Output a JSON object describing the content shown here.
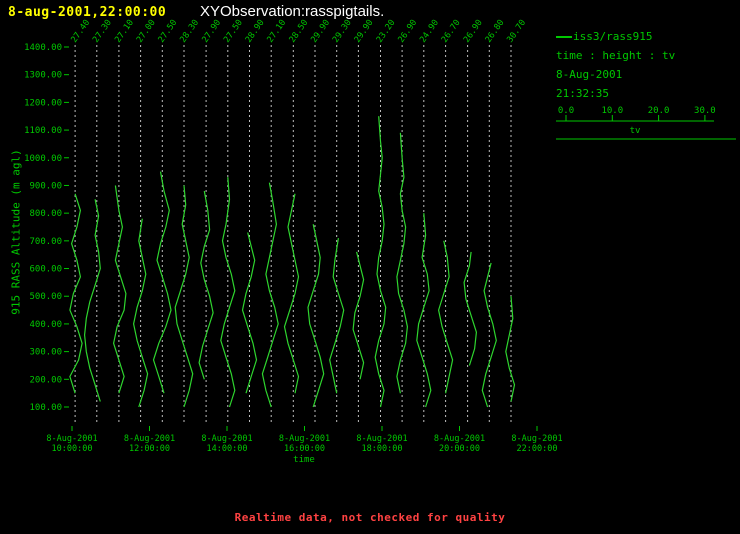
{
  "header": {
    "timestamp": "8-aug-2001,22:00:00",
    "title": "XYObservation:rasspigtails."
  },
  "legend": {
    "series_label": "iss3/rass915",
    "fields": "time : height : tv",
    "date": "8-Aug-2001",
    "time": "21:32:35"
  },
  "footer": {
    "notice": "Realtime data, not checked for quality"
  },
  "colors": {
    "background": "#000000",
    "green_text": "#00c800",
    "profile_green": "#2ed52e",
    "yellow": "#ffff00",
    "white": "#ffffff",
    "gridline_dash": "#e0e0e0",
    "red_notice": "#ff4242"
  },
  "chart_data": {
    "type": "line",
    "title": "XYObservation:rasspigtails.",
    "ylabel": "915 RASS Altitude (m agl)",
    "xlabel": "time",
    "ylim": [
      100,
      1400
    ],
    "yticks": [
      "1400.00",
      "1300.00",
      "1200.00",
      "1100.00",
      "1000.00",
      "900.00",
      "800.00",
      "700.00",
      "600.00",
      "500.00",
      "400.00",
      "300.00",
      "200.00",
      "100.00"
    ],
    "xticks": [
      {
        "hour": 10,
        "date": "8-Aug-2001",
        "time": "10:00:00"
      },
      {
        "hour": 12,
        "date": "8-Aug-2001",
        "time": "12:00:00"
      },
      {
        "hour": 14,
        "date": "8-Aug-2001",
        "time": "14:00:00"
      },
      {
        "hour": 16,
        "date": "8-Aug-2001",
        "time": "16:00:00"
      },
      {
        "hour": 18,
        "date": "8-Aug-2001",
        "time": "18:00:00"
      },
      {
        "hour": 20,
        "date": "8-Aug-2001",
        "time": "20:00:00"
      },
      {
        "hour": 22,
        "date": "8-Aug-2001",
        "time": "22:00:00"
      }
    ],
    "tv_axis": {
      "ticks": [
        "0.0",
        "10.0",
        "20.0",
        "30.0"
      ],
      "range": [
        0,
        30
      ],
      "label": "tv"
    },
    "profiles": [
      {
        "hour": 10.08,
        "label": "27.40",
        "points": [
          [
            150,
            0
          ],
          [
            210,
            -1.5
          ],
          [
            270,
            1
          ],
          [
            330,
            2
          ],
          [
            390,
            0.5
          ],
          [
            450,
            -1.5
          ],
          [
            510,
            -0.5
          ],
          [
            570,
            1.5
          ],
          [
            630,
            0.5
          ],
          [
            690,
            -1
          ],
          [
            750,
            0.5
          ],
          [
            810,
            1.5
          ],
          [
            870,
            0
          ]
        ]
      },
      {
        "hour": 10.64,
        "label": "27.30",
        "points": [
          [
            120,
            1
          ],
          [
            180,
            -0.5
          ],
          [
            240,
            -2
          ],
          [
            300,
            -3
          ],
          [
            360,
            -3.5
          ],
          [
            420,
            -3
          ],
          [
            480,
            -2
          ],
          [
            540,
            -0.5
          ],
          [
            600,
            1
          ],
          [
            660,
            0.5
          ],
          [
            720,
            -0.5
          ],
          [
            790,
            0.5
          ],
          [
            850,
            -0.5
          ]
        ]
      },
      {
        "hour": 11.21,
        "label": "27.10",
        "points": [
          [
            150,
            0
          ],
          [
            210,
            1.5
          ],
          [
            270,
            0
          ],
          [
            330,
            -1.5
          ],
          [
            390,
            -0.5
          ],
          [
            450,
            1.5
          ],
          [
            510,
            2
          ],
          [
            570,
            0.5
          ],
          [
            630,
            -1
          ],
          [
            690,
            0
          ],
          [
            750,
            1
          ],
          [
            810,
            0
          ],
          [
            900,
            -1
          ]
        ]
      },
      {
        "hour": 11.77,
        "label": "27.00",
        "points": [
          [
            100,
            -0.5
          ],
          [
            160,
            1
          ],
          [
            220,
            2
          ],
          [
            280,
            0.5
          ],
          [
            340,
            -1
          ],
          [
            400,
            -2
          ],
          [
            460,
            -1
          ],
          [
            520,
            0.5
          ],
          [
            580,
            1.5
          ],
          [
            640,
            0.5
          ],
          [
            700,
            -0.5
          ],
          [
            780,
            0.5
          ]
        ]
      },
      {
        "hour": 12.33,
        "label": "27.50",
        "points": [
          [
            150,
            0.5
          ],
          [
            210,
            -1
          ],
          [
            270,
            -2.5
          ],
          [
            330,
            -1
          ],
          [
            390,
            1
          ],
          [
            450,
            2.5
          ],
          [
            510,
            1.5
          ],
          [
            570,
            0
          ],
          [
            630,
            -1.5
          ],
          [
            690,
            -0.5
          ],
          [
            750,
            1
          ],
          [
            810,
            2
          ],
          [
            880,
            0.5
          ],
          [
            950,
            -0.5
          ]
        ]
      },
      {
        "hour": 12.89,
        "label": "28.30",
        "points": [
          [
            100,
            0
          ],
          [
            160,
            1.5
          ],
          [
            220,
            2.5
          ],
          [
            280,
            1
          ],
          [
            340,
            -0.5
          ],
          [
            400,
            -2
          ],
          [
            460,
            -2.5
          ],
          [
            520,
            -1
          ],
          [
            580,
            0.5
          ],
          [
            640,
            1.5
          ],
          [
            700,
            0.5
          ],
          [
            760,
            -0.5
          ],
          [
            830,
            0.5
          ],
          [
            900,
            0
          ]
        ]
      },
      {
        "hour": 13.46,
        "label": "27.90",
        "points": [
          [
            200,
            -0.5
          ],
          [
            260,
            -2
          ],
          [
            320,
            -1
          ],
          [
            380,
            0.5
          ],
          [
            440,
            2
          ],
          [
            500,
            1
          ],
          [
            560,
            -0.5
          ],
          [
            620,
            -1.5
          ],
          [
            680,
            -0.5
          ],
          [
            740,
            1
          ],
          [
            810,
            0.5
          ],
          [
            880,
            -0.5
          ]
        ]
      },
      {
        "hour": 14.02,
        "label": "27.50",
        "points": [
          [
            100,
            0.5
          ],
          [
            160,
            2
          ],
          [
            220,
            1
          ],
          [
            280,
            -0.5
          ],
          [
            340,
            -2
          ],
          [
            400,
            -1
          ],
          [
            460,
            0.5
          ],
          [
            520,
            2
          ],
          [
            580,
            1
          ],
          [
            640,
            -0.5
          ],
          [
            700,
            -1.5
          ],
          [
            760,
            -0.5
          ],
          [
            850,
            0.5
          ],
          [
            930,
            0
          ]
        ]
      },
      {
        "hour": 14.58,
        "label": "28.90",
        "points": [
          [
            150,
            -1
          ],
          [
            210,
            0.5
          ],
          [
            270,
            2
          ],
          [
            330,
            1
          ],
          [
            390,
            -0.5
          ],
          [
            450,
            -2
          ],
          [
            510,
            -1
          ],
          [
            570,
            0.5
          ],
          [
            630,
            1.5
          ],
          [
            680,
            0.5
          ],
          [
            730,
            -0.5
          ]
        ]
      },
      {
        "hour": 15.14,
        "label": "27.10",
        "points": [
          [
            100,
            0
          ],
          [
            160,
            -1.5
          ],
          [
            220,
            -2.5
          ],
          [
            280,
            -1
          ],
          [
            340,
            0.5
          ],
          [
            400,
            2
          ],
          [
            460,
            1
          ],
          [
            520,
            -0.5
          ],
          [
            580,
            -1.5
          ],
          [
            640,
            -0.5
          ],
          [
            700,
            0.5
          ],
          [
            760,
            1.5
          ],
          [
            840,
            0.5
          ],
          [
            910,
            -0.5
          ]
        ]
      },
      {
        "hour": 15.71,
        "label": "28.50",
        "points": [
          [
            150,
            0.5
          ],
          [
            210,
            1.5
          ],
          [
            270,
            0
          ],
          [
            330,
            -1.5
          ],
          [
            390,
            -2.5
          ],
          [
            450,
            -1
          ],
          [
            510,
            0.5
          ],
          [
            570,
            1.5
          ],
          [
            630,
            0.5
          ],
          [
            690,
            -0.5
          ],
          [
            750,
            -1.5
          ],
          [
            810,
            -0.5
          ],
          [
            870,
            0.5
          ]
        ]
      },
      {
        "hour": 16.27,
        "label": "29.90",
        "points": [
          [
            100,
            -0.5
          ],
          [
            160,
            1
          ],
          [
            220,
            2.5
          ],
          [
            280,
            1.5
          ],
          [
            340,
            0
          ],
          [
            400,
            -1.5
          ],
          [
            460,
            -2
          ],
          [
            520,
            -0.5
          ],
          [
            580,
            1
          ],
          [
            640,
            1.5
          ],
          [
            700,
            0.5
          ],
          [
            760,
            -0.5
          ]
        ]
      },
      {
        "hour": 16.83,
        "label": "29.30",
        "points": [
          [
            150,
            0
          ],
          [
            210,
            -1
          ],
          [
            270,
            -2
          ],
          [
            330,
            -0.5
          ],
          [
            390,
            1
          ],
          [
            450,
            2
          ],
          [
            510,
            0.5
          ],
          [
            570,
            -1
          ],
          [
            630,
            -0.5
          ],
          [
            710,
            0.5
          ]
        ]
      },
      {
        "hour": 17.39,
        "label": "29.90",
        "points": [
          [
            200,
            0.5
          ],
          [
            260,
            1.5
          ],
          [
            320,
            0
          ],
          [
            380,
            -1.5
          ],
          [
            440,
            -1
          ],
          [
            500,
            0.5
          ],
          [
            560,
            1.5
          ],
          [
            610,
            0.5
          ],
          [
            660,
            -0.5
          ]
        ]
      },
      {
        "hour": 17.96,
        "label": "23.20",
        "points": [
          [
            100,
            0
          ],
          [
            160,
            1
          ],
          [
            220,
            -0.5
          ],
          [
            280,
            -1.5
          ],
          [
            340,
            -0.5
          ],
          [
            400,
            1
          ],
          [
            460,
            1.5
          ],
          [
            520,
            0
          ],
          [
            580,
            -1
          ],
          [
            640,
            -0.5
          ],
          [
            700,
            0.5
          ],
          [
            760,
            1
          ],
          [
            820,
            0.5
          ],
          [
            880,
            -0.5
          ],
          [
            940,
            0
          ],
          [
            1000,
            0.5
          ],
          [
            1060,
            0
          ],
          [
            1150,
            -0.5
          ]
        ]
      },
      {
        "hour": 18.52,
        "label": "26.90",
        "points": [
          [
            150,
            -0.5
          ],
          [
            210,
            -1.5
          ],
          [
            270,
            -0.5
          ],
          [
            330,
            1
          ],
          [
            390,
            1.5
          ],
          [
            450,
            0.5
          ],
          [
            510,
            -1
          ],
          [
            570,
            -1.5
          ],
          [
            630,
            -0.5
          ],
          [
            690,
            0.5
          ],
          [
            750,
            1
          ],
          [
            810,
            0
          ],
          [
            870,
            -0.5
          ],
          [
            930,
            0.5
          ],
          [
            1000,
            0
          ],
          [
            1090,
            -0.5
          ]
        ]
      },
      {
        "hour": 19.08,
        "label": "24.90",
        "points": [
          [
            100,
            0.5
          ],
          [
            160,
            2
          ],
          [
            220,
            1
          ],
          [
            280,
            -0.5
          ],
          [
            340,
            -2
          ],
          [
            400,
            -1.5
          ],
          [
            460,
            0
          ],
          [
            520,
            1.5
          ],
          [
            580,
            1
          ],
          [
            640,
            -0.5
          ],
          [
            720,
            0.5
          ],
          [
            800,
            0
          ]
        ]
      },
      {
        "hour": 19.64,
        "label": "26.70",
        "points": [
          [
            150,
            0
          ],
          [
            210,
            1
          ],
          [
            270,
            2
          ],
          [
            330,
            0.5
          ],
          [
            390,
            -1
          ],
          [
            450,
            -2
          ],
          [
            510,
            -0.5
          ],
          [
            570,
            1
          ],
          [
            640,
            0.5
          ],
          [
            700,
            -0.5
          ]
        ]
      },
      {
        "hour": 20.21,
        "label": "26.90",
        "points": [
          [
            250,
            0.5
          ],
          [
            310,
            2
          ],
          [
            370,
            2.5
          ],
          [
            430,
            1
          ],
          [
            490,
            -0.5
          ],
          [
            550,
            -1
          ],
          [
            610,
            0.5
          ],
          [
            660,
            1
          ]
        ]
      },
      {
        "hour": 20.77,
        "label": "26.80",
        "points": [
          [
            100,
            -0.5
          ],
          [
            160,
            -2
          ],
          [
            220,
            -1
          ],
          [
            280,
            0.5
          ],
          [
            340,
            2
          ],
          [
            400,
            1
          ],
          [
            460,
            -0.5
          ],
          [
            520,
            -1.5
          ],
          [
            570,
            -0.5
          ],
          [
            620,
            0.5
          ]
        ]
      },
      {
        "hour": 21.33,
        "label": "30.70",
        "points": [
          [
            120,
            0
          ],
          [
            180,
            1
          ],
          [
            240,
            -0.5
          ],
          [
            300,
            -1.5
          ],
          [
            360,
            -0.5
          ],
          [
            420,
            0.5
          ],
          [
            500,
            0
          ]
        ]
      }
    ]
  }
}
